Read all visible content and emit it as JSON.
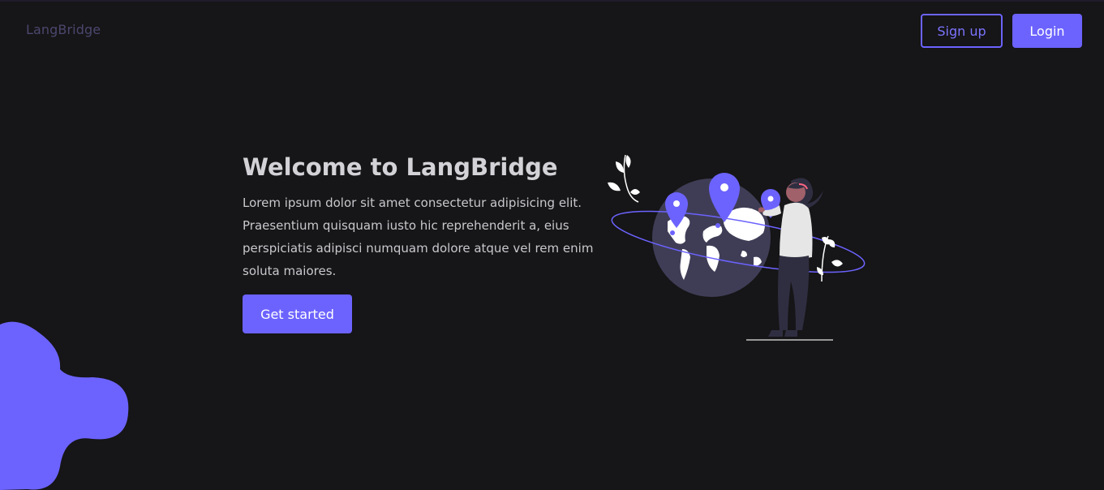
{
  "header": {
    "logo": "LangBridge",
    "signup_label": "Sign up",
    "login_label": "Login"
  },
  "hero": {
    "title": "Welcome to LangBridge",
    "text": "Lorem ipsum dolor sit amet consectetur adipisicing elit. Praesentium quisquam iusto hic reprehenderit a, eius perspiciatis adipisci numquam dolore atque vel rem enim soluta maiores.",
    "cta_label": "Get started"
  },
  "colors": {
    "accent": "#6c63ff",
    "background": "#161517",
    "text": "#d3d2d6"
  },
  "icons": {
    "illustration": "world-map-person-illustration",
    "blob": "decorative-blob"
  }
}
